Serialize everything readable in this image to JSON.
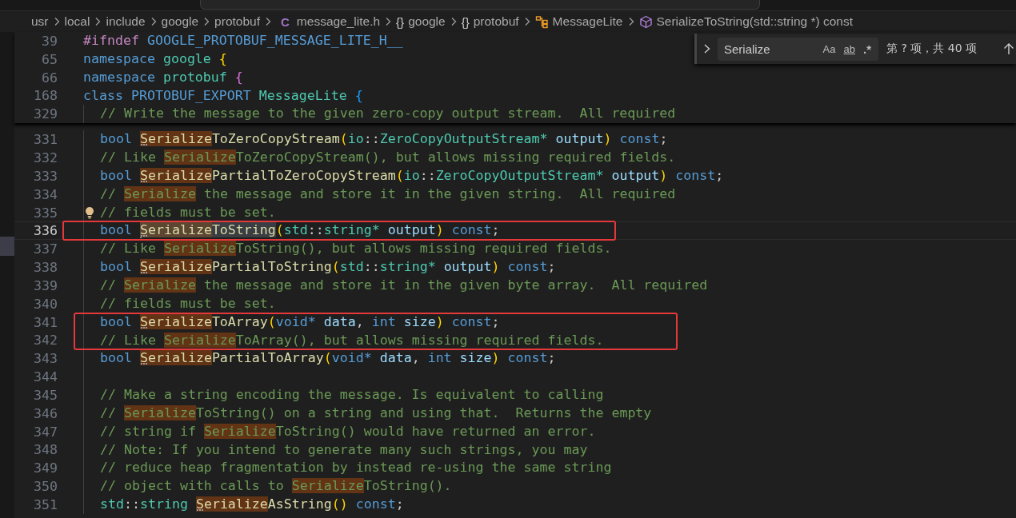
{
  "breadcrumb": [
    {
      "label": "usr",
      "kind": "folder"
    },
    {
      "label": "local",
      "kind": "folder"
    },
    {
      "label": "include",
      "kind": "folder"
    },
    {
      "label": "google",
      "kind": "folder"
    },
    {
      "label": "protobuf",
      "kind": "folder"
    },
    {
      "label": "message_lite.h",
      "kind": "file",
      "icon_text": "C"
    },
    {
      "label": "google",
      "kind": "namespace",
      "icon_text": "{}"
    },
    {
      "label": "protobuf",
      "kind": "namespace",
      "icon_text": "{}"
    },
    {
      "label": "MessageLite",
      "kind": "class"
    },
    {
      "label": "SerializeToString(std::string *) const",
      "kind": "method"
    }
  ],
  "find_widget": {
    "expanded": false,
    "value": "Serialize",
    "options": [
      {
        "label": "Aa",
        "kind": "case",
        "on": false
      },
      {
        "label": "ab",
        "kind": "word",
        "on": false
      },
      {
        "label": ".*",
        "kind": "regex",
        "on": false
      }
    ],
    "match_count": "第 ? 项，共 40 项"
  },
  "sticky_lines": [
    {
      "number": "39",
      "indented": false,
      "tokens": [
        {
          "text": "#ifndef ",
          "kind": "preproc"
        },
        {
          "text": "GOOGLE_PROTOBUF_MESSAGE_LITE_H__",
          "kind": "keyword"
        }
      ]
    },
    {
      "number": "65",
      "indented": false,
      "tokens": [
        {
          "text": "namespace ",
          "kind": "keyword"
        },
        {
          "text": "google ",
          "kind": "type"
        },
        {
          "text": "{",
          "kind": "bracket1"
        }
      ]
    },
    {
      "number": "66",
      "indented": false,
      "tokens": [
        {
          "text": "namespace ",
          "kind": "keyword"
        },
        {
          "text": "protobuf ",
          "kind": "type"
        },
        {
          "text": "{",
          "kind": "bracket2"
        }
      ]
    },
    {
      "number": "168",
      "indented": false,
      "tokens": [
        {
          "text": "class ",
          "kind": "keyword"
        },
        {
          "text": "PROTOBUF_EXPORT ",
          "kind": "keyword"
        },
        {
          "text": "MessageLite ",
          "kind": "type"
        },
        {
          "text": "{",
          "kind": "bracket3"
        }
      ]
    },
    {
      "number": "329",
      "indented": true,
      "tokens": [
        {
          "text": "// Write the message to the given zero-copy output stream.  All required",
          "kind": "comment"
        }
      ]
    }
  ],
  "lines": [
    {
      "number": "331",
      "indented": true,
      "current": false,
      "in_box": false,
      "tokens": [
        {
          "text": "bool ",
          "kind": "keyword"
        },
        {
          "text": "Serialize",
          "kind": "function",
          "match": true,
          "hint": true
        },
        {
          "text": "ToZeroCopyStream",
          "kind": "function"
        },
        {
          "text": "(",
          "kind": "bracket1"
        },
        {
          "text": "io",
          "kind": "type"
        },
        {
          "text": "::",
          "kind": "punct"
        },
        {
          "text": "ZeroCopyOutputStream*",
          "kind": "type"
        },
        {
          "text": " output",
          "kind": "param"
        },
        {
          "text": ")",
          "kind": "bracket1"
        },
        {
          "text": " const",
          "kind": "keyword"
        },
        {
          "text": ";",
          "kind": "punct"
        }
      ]
    },
    {
      "number": "332",
      "indented": true,
      "current": false,
      "in_box": false,
      "tokens": [
        {
          "text": "// Like ",
          "kind": "comment"
        },
        {
          "text": "Serialize",
          "kind": "comment",
          "match": true
        },
        {
          "text": "ToZeroCopyStream(), but allows missing required fields.",
          "kind": "comment"
        }
      ]
    },
    {
      "number": "333",
      "indented": true,
      "current": false,
      "in_box": false,
      "tokens": [
        {
          "text": "bool ",
          "kind": "keyword"
        },
        {
          "text": "Serialize",
          "kind": "function",
          "match": true,
          "hint": true
        },
        {
          "text": "PartialToZeroCopyStream",
          "kind": "function"
        },
        {
          "text": "(",
          "kind": "bracket1"
        },
        {
          "text": "io",
          "kind": "type"
        },
        {
          "text": "::",
          "kind": "punct"
        },
        {
          "text": "ZeroCopyOutputStream*",
          "kind": "type"
        },
        {
          "text": " output",
          "kind": "param"
        },
        {
          "text": ")",
          "kind": "bracket1"
        },
        {
          "text": " const",
          "kind": "keyword"
        },
        {
          "text": ";",
          "kind": "punct"
        }
      ]
    },
    {
      "number": "334",
      "indented": true,
      "current": false,
      "in_box": false,
      "tokens": [
        {
          "text": "// ",
          "kind": "comment"
        },
        {
          "text": "Serialize",
          "kind": "comment",
          "match": true
        },
        {
          "text": " the message and store it in the given string.  All required",
          "kind": "comment"
        }
      ]
    },
    {
      "number": "335",
      "indented": true,
      "current": false,
      "in_box": false,
      "lightbulb": true,
      "tokens": [
        {
          "text": "// fields must be set.",
          "kind": "comment"
        }
      ]
    },
    {
      "number": "336",
      "indented": true,
      "current": true,
      "in_box": true,
      "tokens": [
        {
          "text": "bool ",
          "kind": "keyword"
        },
        {
          "text": "Serialize",
          "kind": "function",
          "match": true,
          "hint": true,
          "highlight": true
        },
        {
          "text": "ToString",
          "kind": "function",
          "highlight": true
        },
        {
          "text": "(",
          "kind": "bracket1"
        },
        {
          "text": "std",
          "kind": "type"
        },
        {
          "text": "::",
          "kind": "punct"
        },
        {
          "text": "string*",
          "kind": "type"
        },
        {
          "text": " output",
          "kind": "param"
        },
        {
          "text": ")",
          "kind": "bracket1"
        },
        {
          "text": " const",
          "kind": "keyword"
        },
        {
          "text": ";",
          "kind": "punct"
        }
      ]
    },
    {
      "number": "337",
      "indented": true,
      "current": false,
      "in_box": false,
      "tokens": [
        {
          "text": "// Like ",
          "kind": "comment"
        },
        {
          "text": "Serialize",
          "kind": "comment",
          "match": true
        },
        {
          "text": "ToString(), but allows missing required fields.",
          "kind": "comment"
        }
      ]
    },
    {
      "number": "338",
      "indented": true,
      "current": false,
      "in_box": false,
      "tokens": [
        {
          "text": "bool ",
          "kind": "keyword"
        },
        {
          "text": "Serialize",
          "kind": "function",
          "match": true,
          "hint": true
        },
        {
          "text": "PartialToString",
          "kind": "function"
        },
        {
          "text": "(",
          "kind": "bracket1"
        },
        {
          "text": "std",
          "kind": "type"
        },
        {
          "text": "::",
          "kind": "punct"
        },
        {
          "text": "string*",
          "kind": "type"
        },
        {
          "text": " output",
          "kind": "param"
        },
        {
          "text": ")",
          "kind": "bracket1"
        },
        {
          "text": " const",
          "kind": "keyword"
        },
        {
          "text": ";",
          "kind": "punct"
        }
      ]
    },
    {
      "number": "339",
      "indented": true,
      "current": false,
      "in_box": false,
      "tokens": [
        {
          "text": "// ",
          "kind": "comment"
        },
        {
          "text": "Serialize",
          "kind": "comment",
          "match": true
        },
        {
          "text": " the message and store it in the given byte array.  All required",
          "kind": "comment"
        }
      ]
    },
    {
      "number": "340",
      "indented": true,
      "current": false,
      "in_box": false,
      "tokens": [
        {
          "text": "// fields must be set.",
          "kind": "comment"
        }
      ]
    },
    {
      "number": "341",
      "indented": true,
      "current": false,
      "in_box": true,
      "tokens": [
        {
          "text": "bool ",
          "kind": "keyword"
        },
        {
          "text": "Serialize",
          "kind": "function",
          "match": true,
          "hint": true
        },
        {
          "text": "ToArray",
          "kind": "function"
        },
        {
          "text": "(",
          "kind": "bracket1"
        },
        {
          "text": "void*",
          "kind": "keyword"
        },
        {
          "text": " data",
          "kind": "param"
        },
        {
          "text": ", ",
          "kind": "punct"
        },
        {
          "text": "int ",
          "kind": "keyword"
        },
        {
          "text": "size",
          "kind": "param"
        },
        {
          "text": ")",
          "kind": "bracket1"
        },
        {
          "text": " const",
          "kind": "keyword"
        },
        {
          "text": ";",
          "kind": "punct"
        }
      ]
    },
    {
      "number": "342",
      "indented": true,
      "current": false,
      "in_box": true,
      "tokens": [
        {
          "text": "// Like ",
          "kind": "comment"
        },
        {
          "text": "Serialize",
          "kind": "comment",
          "match": true
        },
        {
          "text": "ToArray(), but allows missing required fields.",
          "kind": "comment"
        }
      ]
    },
    {
      "number": "343",
      "indented": true,
      "current": false,
      "in_box": false,
      "tokens": [
        {
          "text": "bool ",
          "kind": "keyword"
        },
        {
          "text": "Serialize",
          "kind": "function",
          "match": true,
          "hint": true
        },
        {
          "text": "PartialToArray",
          "kind": "function"
        },
        {
          "text": "(",
          "kind": "bracket1"
        },
        {
          "text": "void*",
          "kind": "keyword"
        },
        {
          "text": " data",
          "kind": "param"
        },
        {
          "text": ", ",
          "kind": "punct"
        },
        {
          "text": "int ",
          "kind": "keyword"
        },
        {
          "text": "size",
          "kind": "param"
        },
        {
          "text": ")",
          "kind": "bracket1"
        },
        {
          "text": " const",
          "kind": "keyword"
        },
        {
          "text": ";",
          "kind": "punct"
        }
      ]
    },
    {
      "number": "344",
      "indented": true,
      "current": false,
      "in_box": false
    },
    {
      "number": "345",
      "indented": true,
      "current": false,
      "in_box": false,
      "tokens": [
        {
          "text": "// Make a string encoding the message. Is equivalent to calling",
          "kind": "comment"
        }
      ]
    },
    {
      "number": "346",
      "indented": true,
      "current": false,
      "in_box": false,
      "tokens": [
        {
          "text": "// ",
          "kind": "comment"
        },
        {
          "text": "Serialize",
          "kind": "comment",
          "match": true
        },
        {
          "text": "ToString() on a string and using that.  Returns the empty",
          "kind": "comment"
        }
      ]
    },
    {
      "number": "347",
      "indented": true,
      "current": false,
      "in_box": false,
      "tokens": [
        {
          "text": "// string if ",
          "kind": "comment"
        },
        {
          "text": "Serialize",
          "kind": "comment",
          "match": true
        },
        {
          "text": "ToString() would have returned an error.",
          "kind": "comment"
        }
      ]
    },
    {
      "number": "348",
      "indented": true,
      "current": false,
      "in_box": false,
      "tokens": [
        {
          "text": "// Note: If you intend to generate many such strings, you may",
          "kind": "comment"
        }
      ]
    },
    {
      "number": "349",
      "indented": true,
      "current": false,
      "in_box": false,
      "tokens": [
        {
          "text": "// reduce heap fragmentation by instead re-using the same string",
          "kind": "comment"
        }
      ]
    },
    {
      "number": "350",
      "indented": true,
      "current": false,
      "in_box": false,
      "tokens": [
        {
          "text": "// object with calls to ",
          "kind": "comment"
        },
        {
          "text": "Serialize",
          "kind": "comment",
          "match": true
        },
        {
          "text": "ToString().",
          "kind": "comment"
        }
      ]
    },
    {
      "number": "351",
      "indented": true,
      "current": false,
      "in_box": false,
      "tokens": [
        {
          "text": "std",
          "kind": "type"
        },
        {
          "text": "::",
          "kind": "punct"
        },
        {
          "text": "string ",
          "kind": "type"
        },
        {
          "text": "Serialize",
          "kind": "function",
          "match": true,
          "hint": true
        },
        {
          "text": "AsString",
          "kind": "function"
        },
        {
          "text": "()",
          "kind": "bracket1"
        },
        {
          "text": " const",
          "kind": "keyword"
        },
        {
          "text": ";",
          "kind": "punct"
        }
      ]
    }
  ]
}
